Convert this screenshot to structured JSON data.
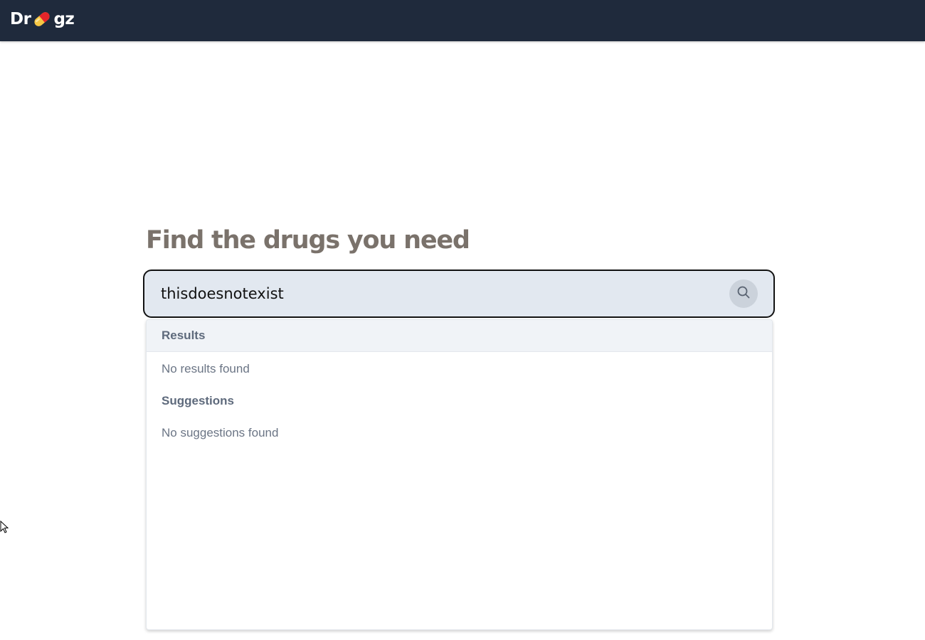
{
  "header": {
    "logo": {
      "prefix": "Dr",
      "suffix": "gz",
      "icon": "pill-icon"
    }
  },
  "main": {
    "title": "Find the drugs you need",
    "search": {
      "value": "thisdoesnotexist",
      "icon": "search-icon"
    },
    "dropdown": {
      "results_label": "Results",
      "results_empty": "No results found",
      "suggestions_label": "Suggestions",
      "suggestions_empty": "No suggestions found"
    }
  },
  "colors": {
    "topbar": "#1f2a3c",
    "heading": "#7a726b",
    "search_background": "#e2e8f0",
    "section_header": "#f0f3f7",
    "pill_red": "#e5252a",
    "pill_yellow": "#f6c744"
  }
}
